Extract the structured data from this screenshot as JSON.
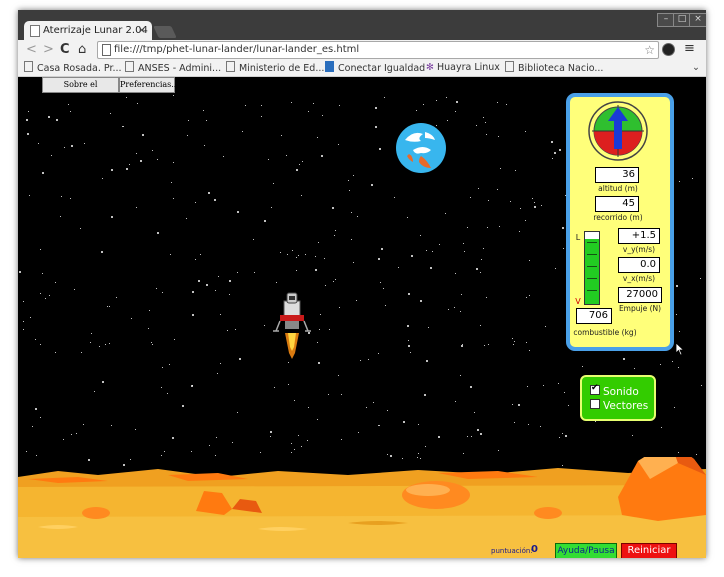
{
  "browser": {
    "tab_title": "Aterrizaje Lunar 2.04",
    "tab_close": "×",
    "url": "file:///tmp/phet-lunar-lander/lunar-lander_es.html",
    "nav": {
      "back": "<",
      "forward": ">",
      "reload": "C",
      "home": "⌂"
    },
    "window_controls": {
      "minimize": "–",
      "maximize": "□",
      "close": "×"
    },
    "menu_icon": "≡",
    "star_icon": "☆",
    "bookmarks": [
      "Casa Rosada. Pr...",
      "ANSES - Admini...",
      "Ministerio de Ed...",
      "Conectar Igualdad",
      "Huayra Linux",
      "Biblioteca Nacio..."
    ]
  },
  "app": {
    "menu": {
      "about": "Sobre el programa...",
      "preferences": "Preferencias..."
    },
    "readouts": {
      "altitude": {
        "value": "36",
        "label": "altitud (m)"
      },
      "range": {
        "value": "45",
        "label": "recorrido (m)"
      },
      "vy": {
        "value": "+1.5",
        "label": "v_y(m/s)"
      },
      "vx": {
        "value": "0.0",
        "label": "v_x(m/s)"
      },
      "thrust": {
        "value": "27000",
        "label": "Empuje (N)"
      },
      "fuel": {
        "value": "706",
        "label": "combustible (kg)"
      },
      "fuel_gauge_top": "L",
      "fuel_gauge_bottom": "V"
    },
    "fuel_level_fraction": 0.9,
    "options": {
      "sound": {
        "label": "Sonido",
        "checked": true
      },
      "vectors": {
        "label": "Vectores",
        "checked": false
      }
    },
    "score": {
      "label": "puntuación:",
      "value": "0"
    },
    "buttons": {
      "help_pause": "Ayuda/Pausa",
      "reset": "Reiniciar"
    }
  },
  "colors": {
    "panel_bg": "#ffff7a",
    "panel_border": "#4aa0e8",
    "options_bg": "#33cc00",
    "help_btn": "#33dd33",
    "reset_btn": "#ee1111",
    "ground": "#f5b530"
  }
}
